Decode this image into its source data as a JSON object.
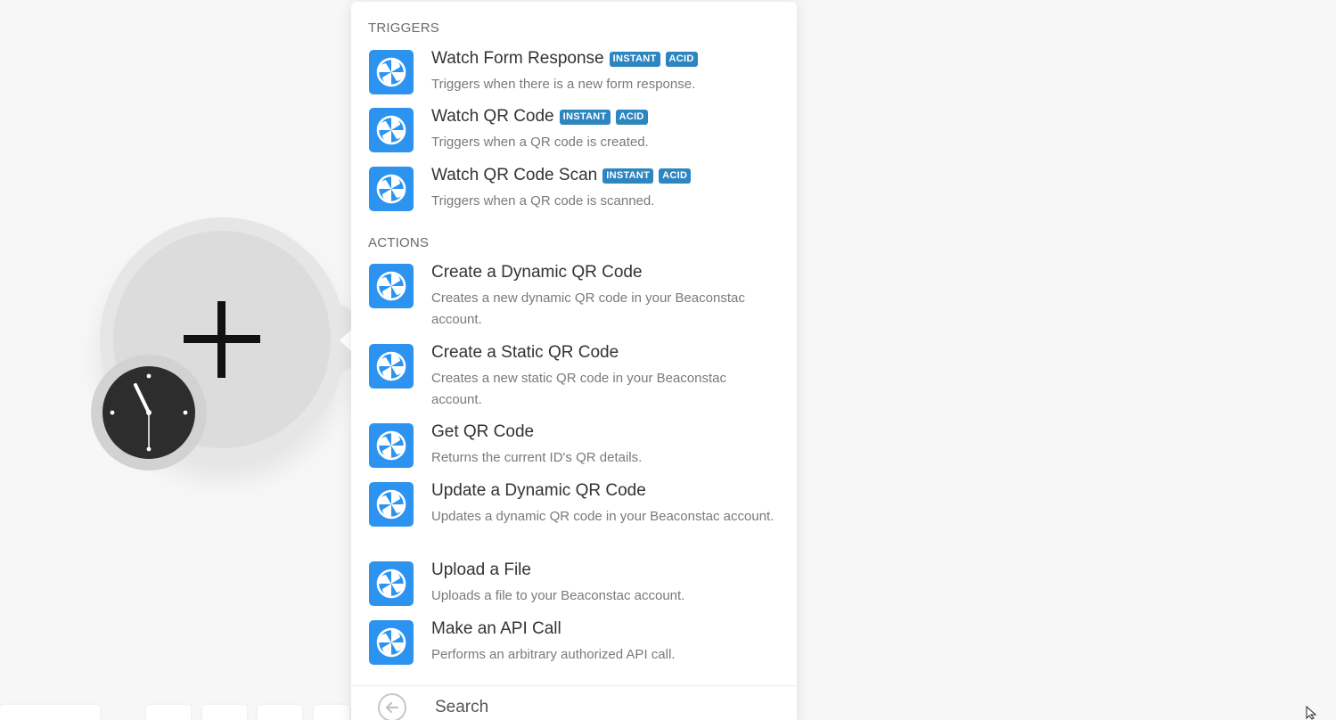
{
  "panel": {
    "triggers_heading": "TRIGGERS",
    "actions_heading": "ACTIONS",
    "triggers": [
      {
        "title": "Watch Form Response",
        "badges": [
          "INSTANT",
          "ACID"
        ],
        "description": "Triggers when there is a new form response."
      },
      {
        "title": "Watch QR Code",
        "badges": [
          "INSTANT",
          "ACID"
        ],
        "description": "Triggers when a QR code is created."
      },
      {
        "title": "Watch QR Code Scan",
        "badges": [
          "INSTANT",
          "ACID"
        ],
        "description": "Triggers when a QR code is scanned."
      }
    ],
    "actions": [
      {
        "title": "Create a Dynamic QR Code",
        "description": "Creates a new dynamic QR code in your Beaconstac account."
      },
      {
        "title": "Create a Static QR Code",
        "description": "Creates a new static QR code in your Beaconstac account."
      },
      {
        "title": "Get QR Code",
        "description": "Returns the current ID's QR details."
      },
      {
        "title": "Update a Dynamic QR Code",
        "description": "Updates a dynamic QR code in your Beaconstac account."
      },
      {
        "title": "Upload a File",
        "description": "Uploads a file to your Beaconstac account."
      },
      {
        "title": "Make an API Call",
        "description": "Performs an arbitrary authorized API call."
      }
    ],
    "search": {
      "label": "Search",
      "back_icon": "arrow-left-icon"
    }
  },
  "colors": {
    "app_icon_bg": "#2d93f0",
    "badge_bg": "#2e86c1",
    "canvas_bg": "#f7f7f7"
  },
  "icons": {
    "app": "beaconstac-pinwheel-icon",
    "module_add": "plus-icon",
    "schedule": "clock-icon"
  }
}
